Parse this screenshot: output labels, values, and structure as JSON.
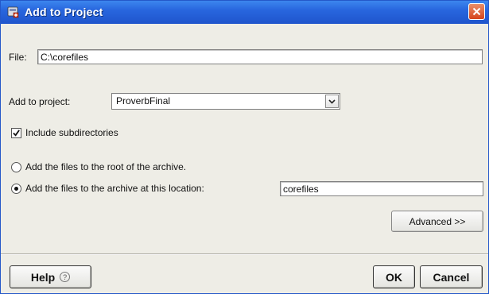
{
  "window": {
    "title": "Add to Project",
    "colors": {
      "titlebar": "#2866de",
      "dialog_bg": "#eeede6",
      "close": "#d6441c"
    }
  },
  "file": {
    "label": "File:",
    "value": "C:\\corefiles"
  },
  "project": {
    "label": "Add to project:",
    "selected": "ProverbFinal"
  },
  "include_subdirs": {
    "label": "Include subdirectories",
    "checked": true
  },
  "location": {
    "root_label": "Add the files to the root of the archive.",
    "root_selected": false,
    "custom_label": "Add the files to the archive at this location:",
    "custom_selected": true,
    "custom_value": "corefiles"
  },
  "buttons": {
    "advanced": "Advanced >>",
    "help": "Help",
    "ok": "OK",
    "cancel": "Cancel"
  },
  "icons": {
    "app": "app-icon",
    "close": "close-icon",
    "help": "help-circle-icon",
    "dropdown": "chevron-down-icon",
    "check": "check-icon"
  }
}
